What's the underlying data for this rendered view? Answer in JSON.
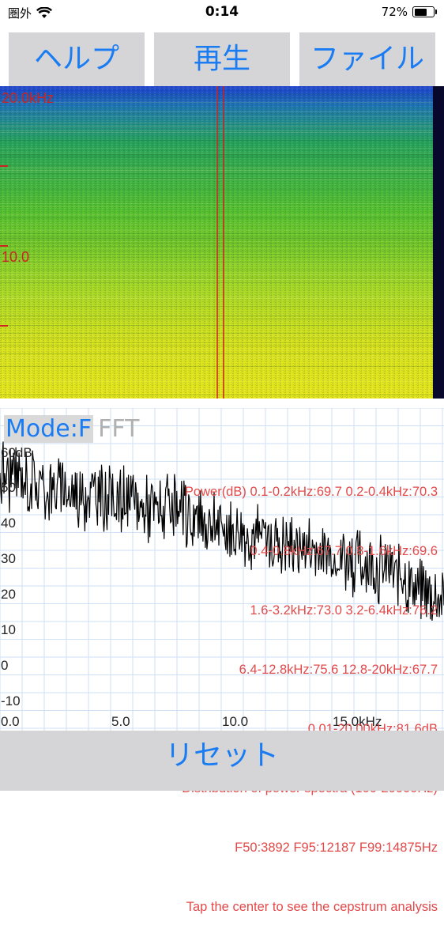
{
  "status_bar": {
    "carrier": "圏外",
    "time": "0:14",
    "battery_text": "72%",
    "battery_level": 0.72
  },
  "toolbar": {
    "help_label": "ヘルプ",
    "play_label": "再生",
    "file_label": "ファイル"
  },
  "spectrogram": {
    "label_top": "20.0kHz",
    "label_mid": "10.0",
    "colors": {
      "low": "#1c3fd1",
      "mid": "#2fbf2c",
      "high": "#e5e61a",
      "cursor": "#cc2222"
    }
  },
  "mode": {
    "active": "Mode:F",
    "inactive": "FFT"
  },
  "info_lines": [
    "Power(dB) 0.1-0.2kHz:69.7 0.2-0.4kHz:70.3",
    "0.4-0.8kHz:67.7 0.8-1.6kHz:69.6",
    "1.6-3.2kHz:73.0 3.2-6.4kHz:76.2",
    "6.4-12.8kHz:75.6 12.8-20kHz:67.7",
    "0.01-20.00kHz:81.6dB",
    "Distribution of power spectra (100-20000Hz)",
    "F50:3892 F95:12187 F99:14875Hz",
    "Tap the center to see the cepstrum analysis"
  ],
  "chart_data": {
    "type": "line",
    "title": "",
    "xlabel": "kHz",
    "ylabel": "dB",
    "x_ticks": [
      "0.0",
      "5.0",
      "10.0",
      "15.0kHz"
    ],
    "y_ticks": [
      "60dB",
      "50",
      "40",
      "30",
      "20",
      "10",
      "0",
      "-10"
    ],
    "xlim": [
      0,
      19.4
    ],
    "ylim": [
      -15,
      63
    ],
    "grid": true,
    "series": [
      {
        "values_x": [
          0,
          1,
          2,
          3,
          4,
          5,
          6,
          7,
          8,
          9,
          10,
          11,
          12,
          13,
          14,
          15,
          16,
          17,
          18,
          19.4
        ],
        "values_y": [
          54,
          52,
          50,
          49,
          48,
          47,
          45,
          44,
          42,
          40,
          38,
          37,
          35,
          34,
          32,
          31,
          29,
          27,
          24,
          18
        ]
      }
    ]
  }
}
